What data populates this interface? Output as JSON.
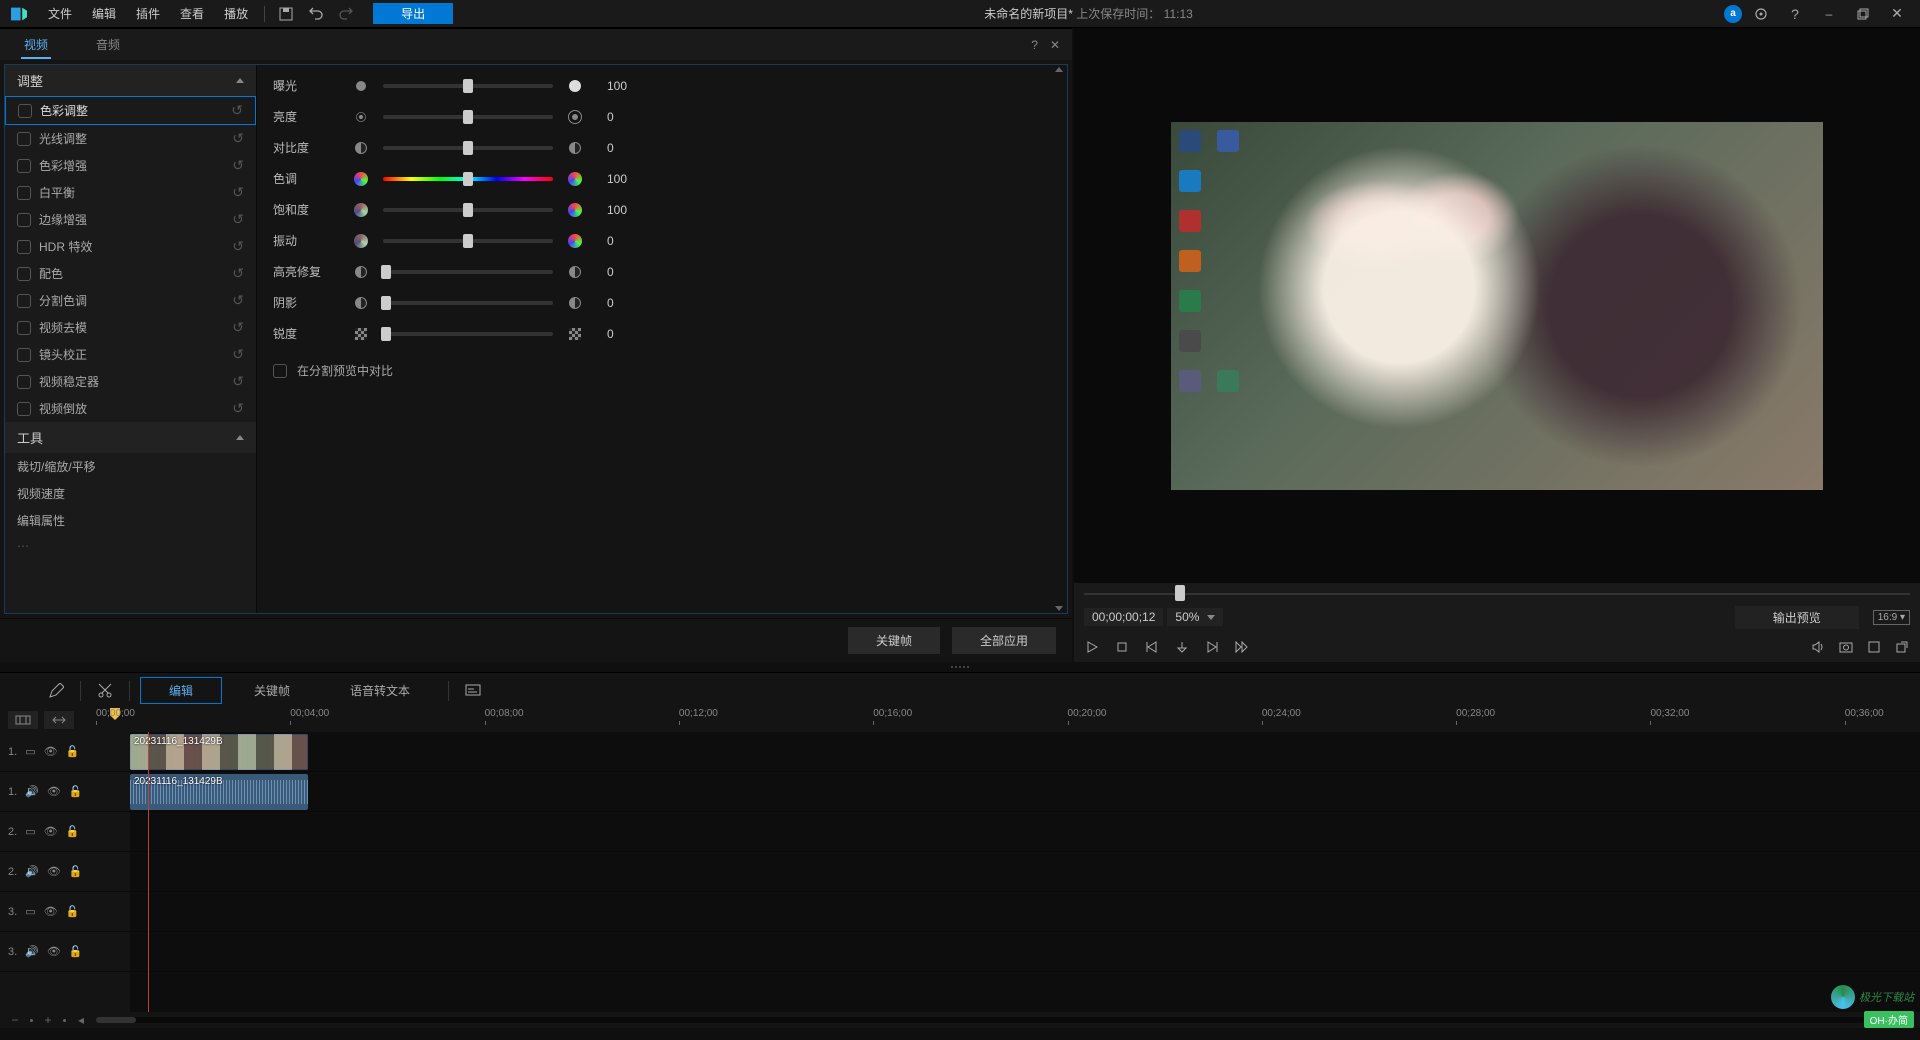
{
  "topmenu": {
    "file": "文件",
    "edit": "编辑",
    "plugin": "插件",
    "view": "查看",
    "play": "播放",
    "export": "导出",
    "project_name": "未命名的新项目*",
    "last_save_label": "上次保存时间：",
    "last_save_time": "11:13"
  },
  "tabs": {
    "video": "视频",
    "audio": "音频"
  },
  "sections": {
    "adjust": "调整",
    "tools": "工具"
  },
  "effects": [
    "色彩调整",
    "光线调整",
    "色彩增强",
    "白平衡",
    "边缘增强",
    "HDR 特效",
    "配色",
    "分割色调",
    "视频去模",
    "镜头校正",
    "视频稳定器",
    "视频倒放"
  ],
  "tools": [
    "裁切/缩放/平移",
    "视频速度",
    "编辑属性"
  ],
  "props": {
    "exposure": {
      "label": "曝光",
      "value": "100",
      "pos": 50
    },
    "brightness": {
      "label": "亮度",
      "value": "0",
      "pos": 50
    },
    "contrast": {
      "label": "对比度",
      "value": "0",
      "pos": 50
    },
    "hue": {
      "label": "色调",
      "value": "100",
      "pos": 50
    },
    "saturation": {
      "label": "饱和度",
      "value": "100",
      "pos": 50
    },
    "vibrance": {
      "label": "振动",
      "value": "0",
      "pos": 50
    },
    "highlight": {
      "label": "高亮修复",
      "value": "0",
      "pos": 2
    },
    "shadow": {
      "label": "阴影",
      "value": "0",
      "pos": 2
    },
    "sharpness": {
      "label": "锐度",
      "value": "0",
      "pos": 2
    },
    "compare_label": "在分割预览中对比"
  },
  "footer": {
    "keyframe": "关键帧",
    "apply_all": "全部应用"
  },
  "preview": {
    "timecode": "00;00;00;12",
    "zoom": "50%",
    "output_preview": "输出预览",
    "aspect": "16:9"
  },
  "timeline_tabs": {
    "edit": "编辑",
    "keyframe": "关键帧",
    "speech": "语音转文本"
  },
  "ruler": {
    "t0": "00;00;00",
    "t1": "00;04;00",
    "t2": "00;08;00",
    "t3": "00;12;00",
    "t4": "00;16;00",
    "t5": "00;20;00",
    "t6": "00;24;00",
    "t7": "00;28;00",
    "t8": "00;32;00",
    "t9": "00;36;00"
  },
  "tracks": {
    "video_prefix": "1.",
    "audio_prefix": "1.",
    "video2_prefix": "2.",
    "audio2_prefix": "2.",
    "video3_prefix": "3.",
    "audio3_prefix": "3.",
    "clip_name": "20231116_131429B"
  },
  "watermark": {
    "brand": "极光下载站",
    "tag": "OH·办简"
  }
}
